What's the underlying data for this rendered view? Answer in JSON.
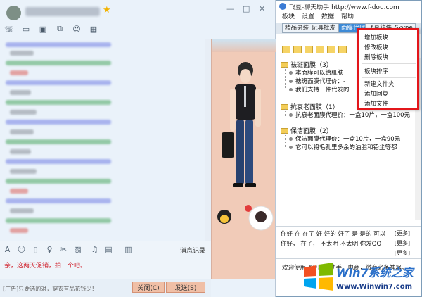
{
  "chat": {
    "star": "★",
    "controls": [
      "—",
      "□",
      "✕"
    ],
    "toolbar_icons": [
      "phone-icon",
      "video-icon",
      "screen-share-icon",
      "remote-icon",
      "group-call-icon",
      "apps-icon"
    ],
    "input_text": "亲，这两天促销，拍一个吧。",
    "history_label": "消息记录",
    "ad_text": "[广告]只要选的对，穿衣有品花钱少！",
    "close_label": "关闭(C)",
    "send_label": "发送(S)"
  },
  "helper": {
    "title": "飞豆-聊天助手 http://www.f-dou.com",
    "menu": [
      "板块",
      "设置",
      "数据",
      "帮助"
    ],
    "tabs": [
      "精品男装",
      "玩具批发",
      "面膜代理",
      "飞豆软件",
      "Skype"
    ],
    "groups": [
      {
        "title": "祛斑面膜（3）",
        "items": [
          "本面膜可以给肌肤",
          "祛斑面膜代理价：-",
          "我们支持一件代发的"
        ]
      },
      {
        "title": "抗衰老面膜（1）",
        "items": [
          "抗衰老面膜代理价：一盒10片，一盒100元"
        ]
      },
      {
        "title": "保洁面膜（2）",
        "items": [
          "保洁面膜代理价：一盒10片，一盒90元",
          "它可以将毛孔里多余的油脂和铅尘等都"
        ]
      }
    ],
    "context_menu": [
      "增加板块",
      "修改板块",
      "删除板块",
      "板块排序",
      "新建文件夹",
      "添加回复",
      "添加文件"
    ],
    "bottom_lines": [
      "你好 在 在了 好 好的 好了 是 是的 可以",
      "你好， 在了， 不太明 不太明 你发QQ"
    ],
    "more_label": "[更多]",
    "marquee": "欢迎使用飞豆聊天助手，电商，微商必备神器。"
  },
  "watermark": {
    "title": "Win7系统之家",
    "url": "Www.Winwin7.com"
  }
}
